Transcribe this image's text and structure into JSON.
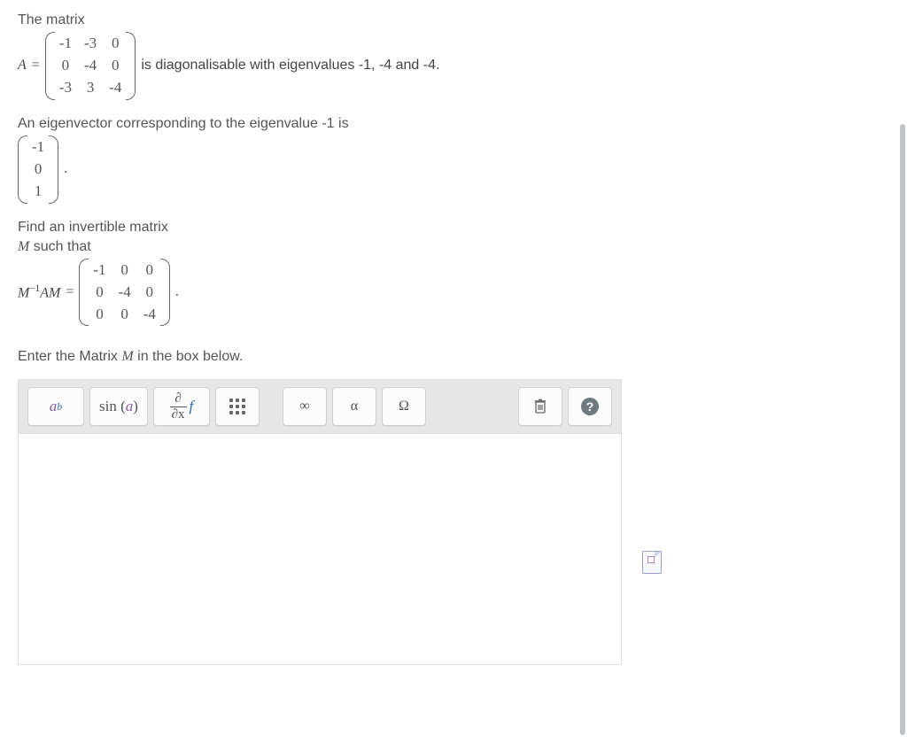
{
  "intro": {
    "label_the_matrix": "The matrix",
    "A_is": "A",
    "equals": "=",
    "matrix_A": [
      [
        "-1",
        "-3",
        "0"
      ],
      [
        "0",
        "-4",
        "0"
      ],
      [
        "-3",
        "3",
        "-4"
      ]
    ],
    "diag_text": "is diagonalisable with eigenvalues ",
    "eigenvalues": "-1, -4 and -4.",
    "eigvec_intro": "An eigenvector corresponding to the eigenvalue ",
    "eigval_minus1": "-1",
    "eigvec_intro_end": " is",
    "eigenvector": [
      "-1",
      "0",
      "1"
    ],
    "period": "."
  },
  "task": {
    "find_text": "Find an invertible matrix",
    "M_such_that": " such that",
    "M_var": "M",
    "lhs_M": "M",
    "lhs_inv": "−1",
    "lhs_A": "A",
    "lhs_M2": "M",
    "target_matrix": [
      [
        "-1",
        "0",
        "0"
      ],
      [
        "0",
        "-4",
        "0"
      ],
      [
        "0",
        "0",
        "-4"
      ]
    ],
    "enter_text_pre": "Enter the Matrix ",
    "enter_text_post": "   in the box below."
  },
  "toolbar": {
    "ab_a": "a",
    "ab_b": "b",
    "sin_label": "sin",
    "sin_arg": "a",
    "frac_num": "∂",
    "frac_den": "∂x",
    "frac_side": "f",
    "infinity": "∞",
    "alpha": "α",
    "omega": "Ω",
    "help": "?"
  }
}
